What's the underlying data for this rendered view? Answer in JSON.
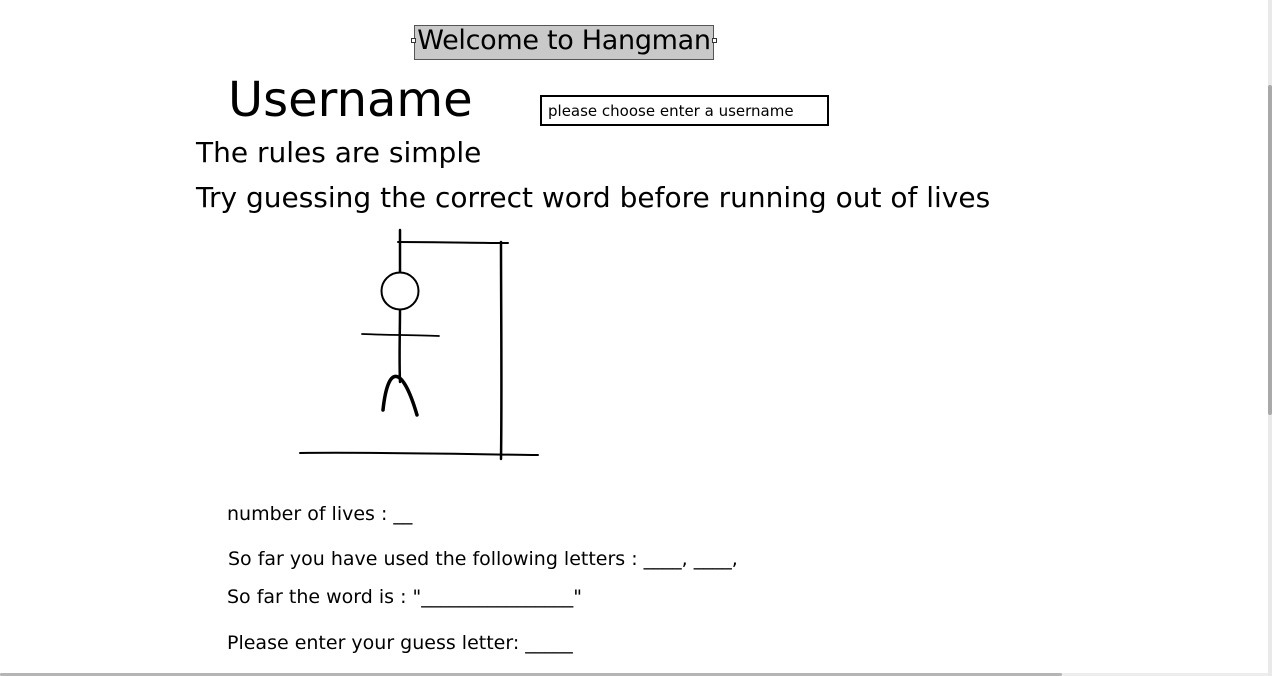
{
  "title": "Welcome to Hangman",
  "username": {
    "label": "Username",
    "placeholder": "please choose enter a username"
  },
  "rules": {
    "line1": "The rules are simple",
    "line2": "Try guessing the correct word before running out of lives"
  },
  "status": {
    "lives": "number of lives : __",
    "letters": "So far you have used the following letters : ____, ____,",
    "word": "So far the word is : \"________________\"",
    "guess": "Please enter your guess letter: _____"
  }
}
